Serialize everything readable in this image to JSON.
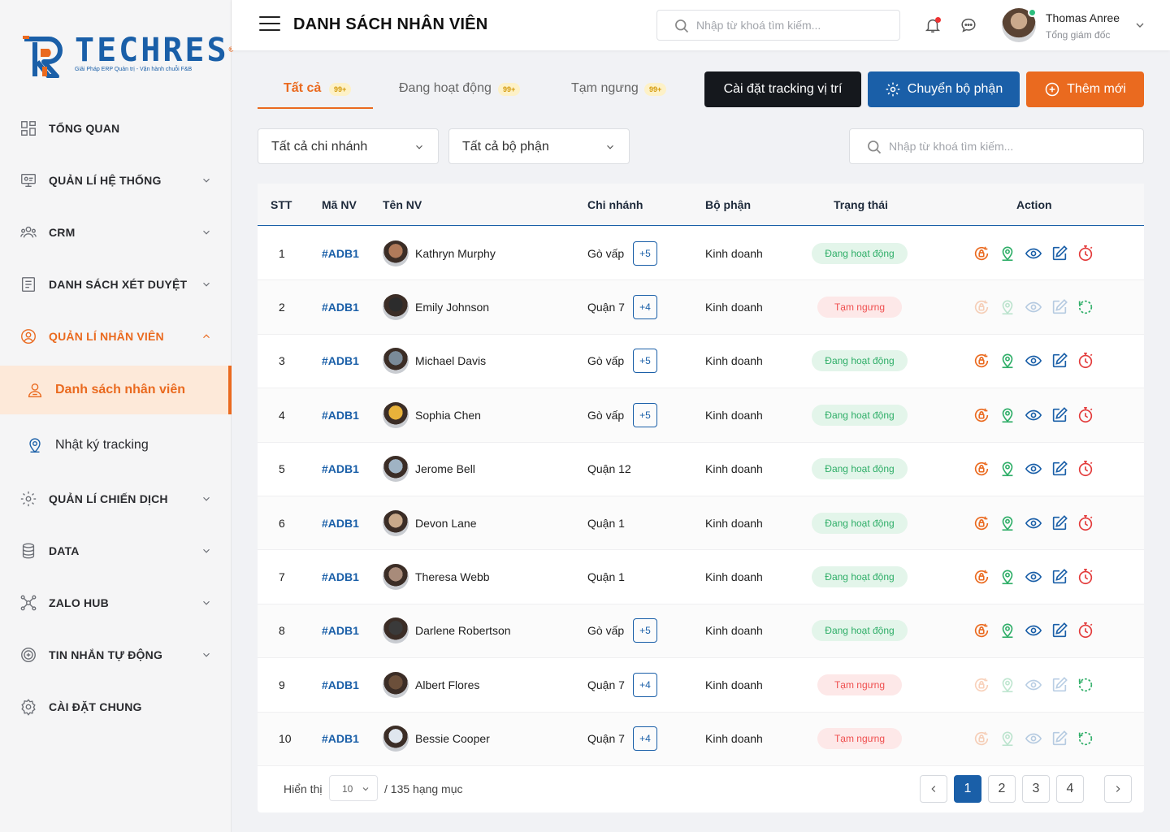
{
  "brand": {
    "name": "TECHRES",
    "reg": "®",
    "tagline": "Giải Pháp ERP Quản trị - Vận hành chuỗi F&B",
    "primary_color": "#1a5fa8",
    "accent_color": "#ea6a1f"
  },
  "sidebar": {
    "items": [
      {
        "label": "TỔNG QUAN",
        "icon": "dashboard-icon"
      },
      {
        "label": "QUẢN LÍ HỆ THỐNG",
        "icon": "system-icon"
      },
      {
        "label": "CRM",
        "icon": "crm-icon"
      },
      {
        "label": "DANH SÁCH XÉT DUYỆT",
        "icon": "approval-list-icon"
      },
      {
        "label": "QUẢN LÍ NHÂN VIÊN",
        "icon": "employee-icon"
      },
      {
        "label": "QUẢN LÍ CHIẾN DỊCH",
        "icon": "campaign-icon"
      },
      {
        "label": "DATA",
        "icon": "database-icon"
      },
      {
        "label": "ZALO HUB",
        "icon": "hub-icon"
      },
      {
        "label": "TIN NHẮN TỰ ĐỘNG",
        "icon": "auto-message-icon"
      },
      {
        "label": "CÀI ĐẶT CHUNG",
        "icon": "settings-icon"
      }
    ],
    "sub_items": [
      {
        "label": "Danh sách nhân viên",
        "icon": "user-list-icon",
        "active": true
      },
      {
        "label": "Nhật ký tracking",
        "icon": "location-pin-icon",
        "active": false
      }
    ]
  },
  "header": {
    "title": "DANH SÁCH NHÂN VIÊN",
    "search_placeholder": "Nhập từ khoá tìm kiếm...",
    "user": {
      "name": "Thomas Anree",
      "role": "Tổng giám đốc"
    }
  },
  "tabs": [
    {
      "label": "Tất cả",
      "badge": "99+",
      "active": true
    },
    {
      "label": "Đang hoạt động",
      "badge": "99+",
      "active": false
    },
    {
      "label": "Tạm ngưng",
      "badge": "99+",
      "active": false
    }
  ],
  "actions": {
    "tracking": "Cài đặt tracking vị trí",
    "transfer": "Chuyển bộ phận",
    "add": "Thêm mới"
  },
  "filters": {
    "branch": "Tất cả chi nhánh",
    "department": "Tất cả bộ phận",
    "search_placeholder": "Nhập từ khoá tìm kiếm..."
  },
  "table": {
    "columns": [
      "STT",
      "Mã NV",
      "Tên NV",
      "Chi nhánh",
      "Bộ phận",
      "Trạng thái",
      "Action"
    ],
    "rows": [
      {
        "stt": "1",
        "code": "#ADB1",
        "name": "Kathryn Murphy",
        "branch": "Gò vấp",
        "extra": "+5",
        "dept": "Kinh doanh",
        "status": "Đang hoạt động",
        "active": true,
        "avatar_color": "#b07a5a"
      },
      {
        "stt": "2",
        "code": "#ADB1",
        "name": "Emily Johnson",
        "branch": "Quận 7",
        "extra": "+4",
        "dept": "Kinh doanh",
        "status": "Tạm ngưng",
        "active": false,
        "avatar_color": "#2c2c2c"
      },
      {
        "stt": "3",
        "code": "#ADB1",
        "name": "Michael Davis",
        "branch": "Gò vấp",
        "extra": "+5",
        "dept": "Kinh doanh",
        "status": "Đang hoạt động",
        "active": true,
        "avatar_color": "#7a8a98"
      },
      {
        "stt": "4",
        "code": "#ADB1",
        "name": "Sophia Chen",
        "branch": "Gò vấp",
        "extra": "+5",
        "dept": "Kinh doanh",
        "status": "Đang hoạt động",
        "active": true,
        "avatar_color": "#e8b23a"
      },
      {
        "stt": "5",
        "code": "#ADB1",
        "name": "Jerome Bell",
        "branch": "Quận 12",
        "extra": "",
        "dept": "Kinh doanh",
        "status": "Đang hoạt động",
        "active": true,
        "avatar_color": "#9fb3c4"
      },
      {
        "stt": "6",
        "code": "#ADB1",
        "name": "Devon Lane",
        "branch": "Quận 1",
        "extra": "",
        "dept": "Kinh doanh",
        "status": "Đang hoạt động",
        "active": true,
        "avatar_color": "#c9a98a"
      },
      {
        "stt": "7",
        "code": "#ADB1",
        "name": "Theresa Webb",
        "branch": "Quận 1",
        "extra": "",
        "dept": "Kinh doanh",
        "status": "Đang hoạt động",
        "active": true,
        "avatar_color": "#a88b7a"
      },
      {
        "stt": "8",
        "code": "#ADB1",
        "name": "Darlene Robertson",
        "branch": "Gò vấp",
        "extra": "+5",
        "dept": "Kinh doanh",
        "status": "Đang hoạt động",
        "active": true,
        "avatar_color": "#3a3a3a"
      },
      {
        "stt": "9",
        "code": "#ADB1",
        "name": "Albert Flores",
        "branch": "Quận 7",
        "extra": "+4",
        "dept": "Kinh doanh",
        "status": "Tạm ngưng",
        "active": false,
        "avatar_color": "#6b4f3a"
      },
      {
        "stt": "10",
        "code": "#ADB1",
        "name": "Bessie Cooper",
        "branch": "Quận 7",
        "extra": "+4",
        "dept": "Kinh doanh",
        "status": "Tạm ngưng",
        "active": false,
        "avatar_color": "#dfe6ee"
      }
    ]
  },
  "pagination": {
    "show_label": "Hiển thị",
    "page_size": "10",
    "total_label": "/ 135 hạng mục",
    "pages": [
      "1",
      "2",
      "3",
      "4"
    ],
    "current": "1"
  }
}
